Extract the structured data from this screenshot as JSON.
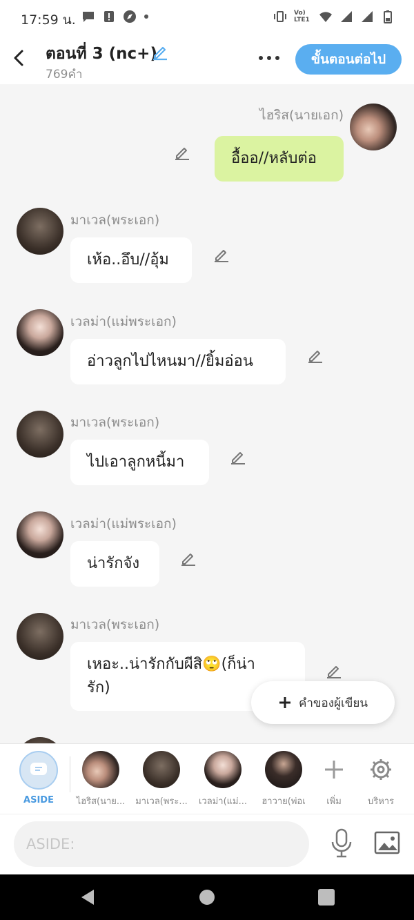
{
  "status_bar": {
    "time": "17:59 น.",
    "network_label": "Vo) LTE1"
  },
  "header": {
    "title": "ตอนที่ 3 (nc+)",
    "subtitle": "769คำ",
    "next_button": "ขั้นตอนต่อไป"
  },
  "messages": [
    {
      "sender": "ไฮริส(นายเอก)",
      "text": "อื้ออ//หลับต่อ",
      "mine": true
    },
    {
      "sender": "มาเวล(พระเอก)",
      "text": "เห้อ..อึบ//อุ้ม",
      "mine": false
    },
    {
      "sender": "เวลม่า(แม่พระเอก)",
      "text": "อ่าวลูกไปไหนมา//ยิ้มอ่อน",
      "mine": false
    },
    {
      "sender": "มาเวล(พระเอก)",
      "text": "ไปเอาลูกหนี้มา",
      "mine": false
    },
    {
      "sender": "เวลม่า(แม่พระเอก)",
      "text": "น่ารักจัง",
      "mine": false
    },
    {
      "sender": "มาเวล(พระเอก)",
      "text_line1": "เหอะ..น่ารักกับผีสิ🙄(ก็น่า",
      "text_line2": "รัก)",
      "mine": false
    }
  ],
  "fab": {
    "label": "คำของผู้เขียน"
  },
  "character_bar": {
    "aside_label": "ASIDE",
    "characters": [
      "ไฮริส(นาย...",
      "มาเวล(พระ...",
      "เวลม่า(แม่...",
      "ฮาวาย(พ่อเ"
    ],
    "add_label": "เพิ่ม",
    "manage_label": "บริหาร"
  },
  "composer": {
    "placeholder": "ASIDE:"
  },
  "colors": {
    "accent": "#5aaef0",
    "my_bubble": "#dbf3a1",
    "background": "#f5f5f5"
  }
}
